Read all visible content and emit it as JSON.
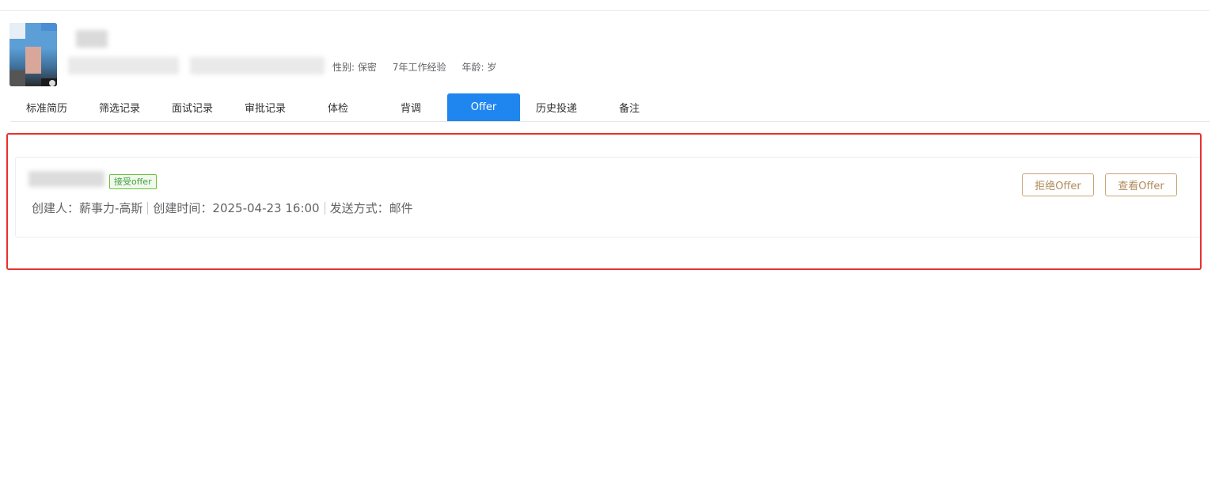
{
  "profile": {
    "gender": "性别: 保密",
    "experience": "7年工作经验",
    "age": "年龄: 岁"
  },
  "tabs": [
    {
      "label": "标准简历",
      "active": false
    },
    {
      "label": "筛选记录",
      "active": false
    },
    {
      "label": "面试记录",
      "active": false
    },
    {
      "label": "审批记录",
      "active": false
    },
    {
      "label": "体检",
      "active": false
    },
    {
      "label": "背调",
      "active": false
    },
    {
      "label": "Offer",
      "active": true
    },
    {
      "label": "历史投递",
      "active": false
    },
    {
      "label": "备注",
      "active": false
    }
  ],
  "offer": {
    "status": "接受offer",
    "creator": "创建人：薪事力-高斯",
    "created_time": "创建时间：2025-04-23 16:00",
    "send_method": "发送方式：邮件",
    "reject_label": "拒绝Offer",
    "view_label": "查看Offer"
  },
  "colors": {
    "active_tab": "#1f86ef",
    "highlight_border": "#e8312f",
    "status_green": "#67c23a",
    "button_gold": "#c9a477"
  }
}
